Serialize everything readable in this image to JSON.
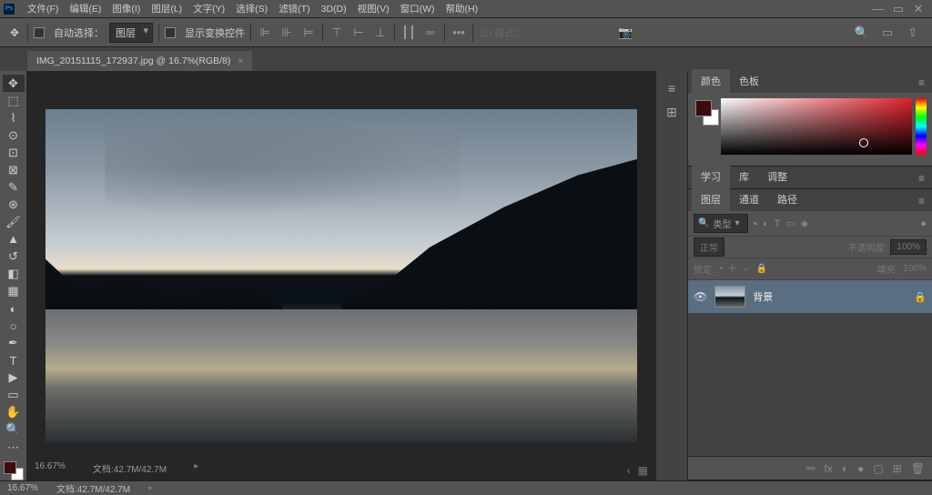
{
  "menubar": {
    "items": [
      "文件(F)",
      "编辑(E)",
      "图像(I)",
      "图层(L)",
      "文字(Y)",
      "选择(S)",
      "滤镜(T)",
      "3D(D)",
      "视图(V)",
      "窗口(W)",
      "帮助(H)"
    ]
  },
  "optbar": {
    "autoselect": "自动选择：",
    "layer_dd": "图层",
    "showtransform": "显示变换控件",
    "mode3d": "3D 模式："
  },
  "tab": {
    "title": "IMG_20151115_172937.jpg @ 16.7%(RGB/8)"
  },
  "canvas": {
    "zoom": "16.67%",
    "docinfo": "文档:42.7M/42.7M"
  },
  "panels": {
    "color_tabs": [
      "颜色",
      "色板"
    ],
    "study_tabs": [
      "学习",
      "库",
      "调整"
    ],
    "layer_tabs": [
      "图层",
      "通道",
      "路径"
    ],
    "filter_label": "类型",
    "blend_mode": "正常",
    "opacity_lbl": "不透明度:",
    "opacity_val": "100%",
    "lock_lbl": "锁定:",
    "fill_lbl": "填充:",
    "fill_val": "100%",
    "layers": [
      {
        "name": "背景"
      }
    ]
  },
  "status": {
    "zoom": "16.67%",
    "doc": "文档:42.7M/42.7M"
  }
}
